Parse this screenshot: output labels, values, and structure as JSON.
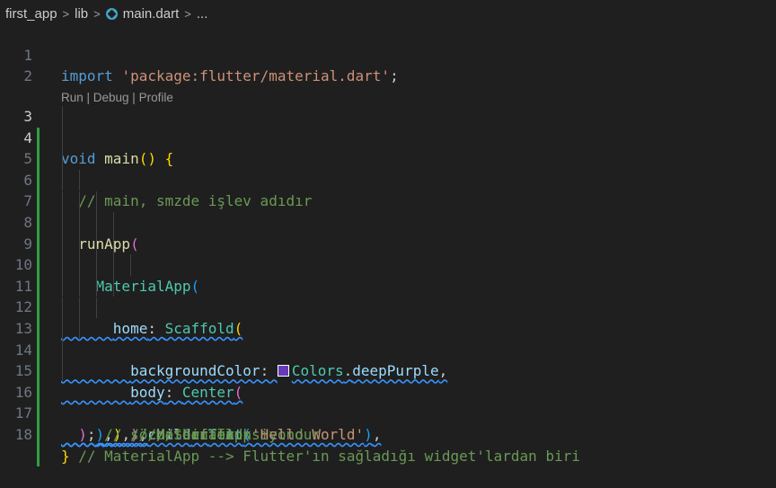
{
  "breadcrumb": {
    "items": [
      "first_app",
      "lib",
      "main.dart",
      "..."
    ],
    "separator": ">"
  },
  "codelens": {
    "text": "Run | Debug | Profile"
  },
  "colors": {
    "background": "#1f1f1f",
    "keyword": "#569cd6",
    "string": "#ce9178",
    "function": "#dcdcaa",
    "class": "#4ec9b0",
    "property": "#9cdcfe",
    "comment": "#6a9955",
    "gutter_modified": "#2ea043",
    "swatch_deep_purple": "#673ab7"
  },
  "icons": {
    "file": "dart-file-icon"
  },
  "lines": {
    "l1": {
      "n": "1",
      "kw": "import",
      "sp": " ",
      "str": "'package:flutter/material.dart'",
      "end": ";"
    },
    "l2": {
      "n": "2"
    },
    "l3": {
      "n": "3",
      "kw": "void",
      "sp": " ",
      "fn": "main",
      "open": "()",
      "sp2": " ",
      "brace": "{"
    },
    "l4": {
      "n": "4",
      "indent": "  ",
      "cmt": "// main, smzde işlev adıdır"
    },
    "l5": {
      "n": "5"
    },
    "l6": {
      "n": "6",
      "indent": "  ",
      "fn": "runApp",
      "open": "("
    },
    "l7": {
      "n": "7",
      "indent": "    ",
      "cls": "MaterialApp",
      "open": "("
    },
    "l8": {
      "n": "8",
      "indent": "      ",
      "prop": "home",
      "colon": ": ",
      "cls": "Scaffold",
      "open": "("
    },
    "l9": {
      "n": "9",
      "indent": "        ",
      "prop": "backgroundColor",
      "colon": ": ",
      "cls": "Colors",
      "dot": ".",
      "prop2": "deepPurple",
      "end": ","
    },
    "l10": {
      "n": "10",
      "indent": "        ",
      "prop": "body",
      "colon": ": ",
      "cls": "Center",
      "open": "("
    },
    "l11": {
      "n": "11",
      "indent": "          ",
      "prop": "child",
      "colon": ": ",
      "cls": "Text",
      "open": "(",
      "str": "'Hello World'",
      "close": ")",
      "end": ","
    },
    "l12": {
      "n": "12",
      "indent": "        ",
      "close": ")",
      "end": ",",
      "cmt": " // Center"
    },
    "l13": {
      "n": "13",
      "indent": "      ",
      "close": ")",
      "end": ",",
      "cmt": "  // Scaffold"
    },
    "l14": {
      "n": "14",
      "indent": "    ",
      "close": ")",
      "end": ",",
      "cmt": "  // MaterialApp"
    },
    "l15": {
      "n": "15",
      "indent": "  ",
      "close": ")",
      "end": ";",
      "cmt": " // sözde bir fonksiyondur"
    },
    "l16": {
      "n": "16",
      "indent": "  ",
      "cmt": "// MaterialApp --> Flutter'ın sağladığı widget'lardan biri"
    },
    "l17": {
      "n": "17",
      "brace": "}"
    },
    "l18": {
      "n": "18"
    }
  }
}
